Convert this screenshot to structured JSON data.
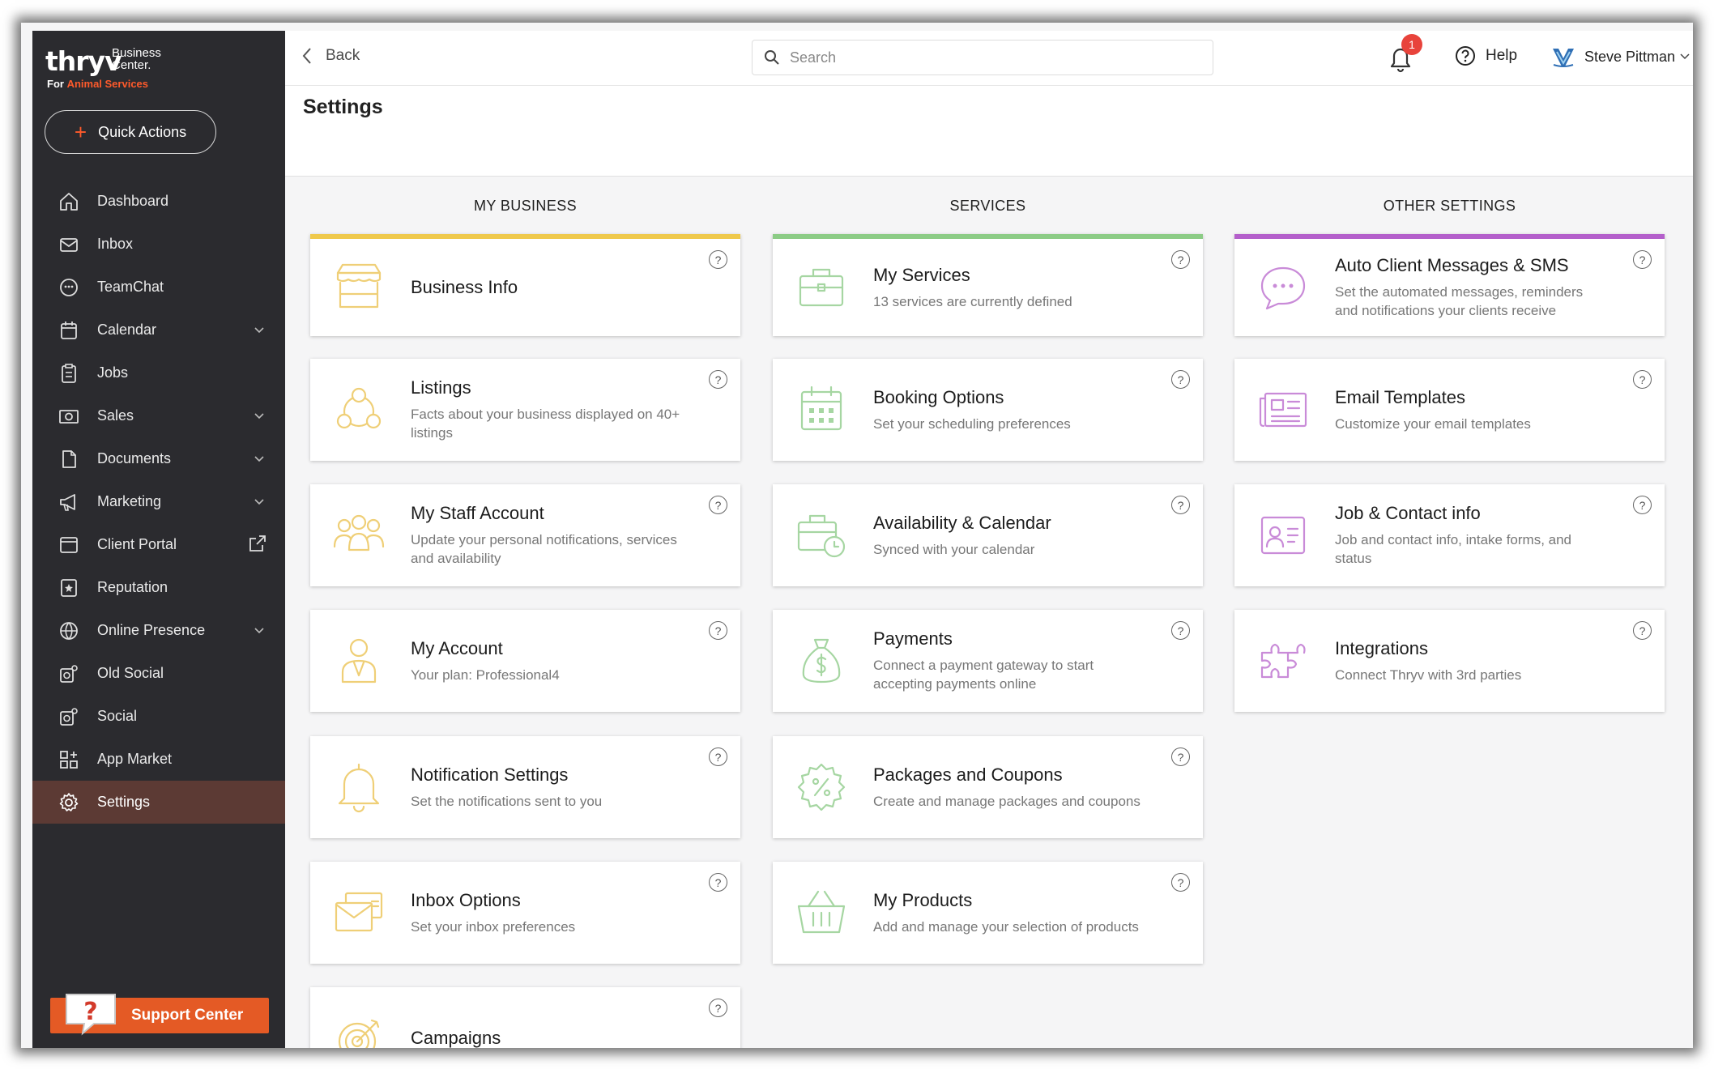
{
  "brand": {
    "logo_text": "thryv",
    "logo_sub_line1": "Business",
    "logo_sub_line2": "Center.",
    "for_prefix": "For ",
    "for_accent": "Animal Services",
    "accent_color": "#ff5a2b"
  },
  "sidebar": {
    "quick_actions": "Quick Actions",
    "items": [
      {
        "label": "Dashboard",
        "icon": "home-icon",
        "dropdown": false
      },
      {
        "label": "Inbox",
        "icon": "envelope-icon",
        "dropdown": false
      },
      {
        "label": "TeamChat",
        "icon": "chat-icon",
        "dropdown": false
      },
      {
        "label": "Calendar",
        "icon": "calendar-icon",
        "dropdown": true
      },
      {
        "label": "Jobs",
        "icon": "clipboard-icon",
        "dropdown": false
      },
      {
        "label": "Sales",
        "icon": "cash-icon",
        "dropdown": true
      },
      {
        "label": "Documents",
        "icon": "document-icon",
        "dropdown": true
      },
      {
        "label": "Marketing",
        "icon": "megaphone-icon",
        "dropdown": true
      },
      {
        "label": "Client Portal",
        "icon": "browser-icon",
        "dropdown": false,
        "external": true
      },
      {
        "label": "Reputation",
        "icon": "star-icon",
        "dropdown": false
      },
      {
        "label": "Online Presence",
        "icon": "globe-icon",
        "dropdown": true
      },
      {
        "label": "Old Social",
        "icon": "social-icon",
        "dropdown": false
      },
      {
        "label": "Social",
        "icon": "social-icon",
        "dropdown": false
      },
      {
        "label": "App Market",
        "icon": "apps-icon",
        "dropdown": false
      },
      {
        "label": "Settings",
        "icon": "gear-icon",
        "dropdown": false,
        "active": true
      }
    ],
    "support_center": "Support Center",
    "support_glyph": "?"
  },
  "topbar": {
    "back_label": "Back",
    "search_placeholder": "Search",
    "notification_count": "1",
    "help_label": "Help",
    "user_name": "Steve Pittman"
  },
  "page": {
    "title": "Settings"
  },
  "help_glyph": "?",
  "columns": [
    {
      "title": "MY BUSINESS",
      "accent": "#efc94c",
      "cards": [
        {
          "title": "Business Info",
          "subtitle": "",
          "icon": "storefront-icon"
        },
        {
          "title": "Listings",
          "subtitle": "Facts about your business displayed on 40+ listings",
          "icon": "listings-network-icon"
        },
        {
          "title": "My Staff Account",
          "subtitle": "Update your personal notifications, services and availability",
          "icon": "staff-group-icon"
        },
        {
          "title": "My Account",
          "subtitle": "Your plan: Professional4",
          "icon": "account-person-icon"
        },
        {
          "title": "Notification Settings",
          "subtitle": "Set the notifications sent to you",
          "icon": "bell-icon"
        },
        {
          "title": "Inbox Options",
          "subtitle": "Set your inbox preferences",
          "icon": "inbox-envelopes-icon"
        },
        {
          "title": "Campaigns",
          "subtitle": "",
          "icon": "target-icon"
        }
      ]
    },
    {
      "title": "SERVICES",
      "accent": "#8ccc86",
      "cards": [
        {
          "title": "My Services",
          "subtitle": "13 services are currently defined",
          "icon": "briefcase-icon"
        },
        {
          "title": "Booking Options",
          "subtitle": "Set your scheduling preferences",
          "icon": "calendar-grid-icon"
        },
        {
          "title": "Availability & Calendar",
          "subtitle": "Synced with your calendar",
          "icon": "briefcase-clock-icon"
        },
        {
          "title": "Payments",
          "subtitle": "Connect a payment gateway to start accepting payments online",
          "icon": "money-bag-icon"
        },
        {
          "title": "Packages and Coupons",
          "subtitle": "Create and manage packages and coupons",
          "icon": "coupon-percent-icon"
        },
        {
          "title": "My Products",
          "subtitle": "Add and manage your selection of products",
          "icon": "basket-icon"
        }
      ]
    },
    {
      "title": "OTHER SETTINGS",
      "accent": "#b45fcb",
      "cards": [
        {
          "title": "Auto Client Messages & SMS",
          "subtitle": "Set the automated messages, reminders and notifications your clients receive",
          "icon": "speech-bubble-icon"
        },
        {
          "title": "Email Templates",
          "subtitle": "Customize your email templates",
          "icon": "newspaper-icon"
        },
        {
          "title": "Job & Contact info",
          "subtitle": "Job and contact info, intake forms, and status",
          "icon": "contact-card-icon"
        },
        {
          "title": "Integrations",
          "subtitle": "Connect Thryv with 3rd parties",
          "icon": "puzzle-icon"
        }
      ]
    }
  ]
}
